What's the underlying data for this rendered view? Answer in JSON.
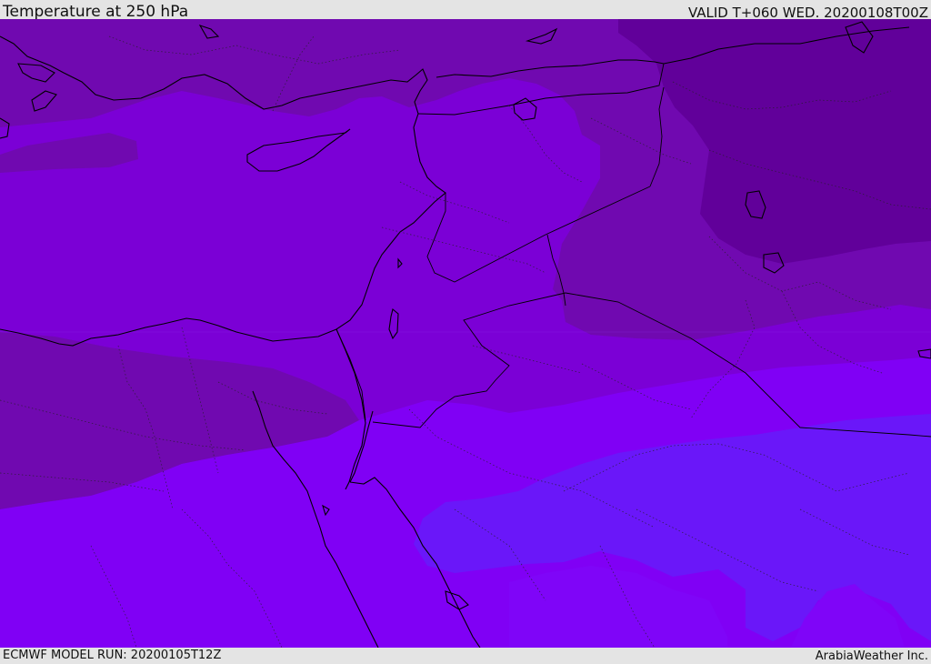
{
  "header": {
    "title": "Temperature at 250 hPa",
    "valid": "VALID T+060 WED. 20200108T00Z"
  },
  "footer": {
    "model_run": "ECMWF MODEL RUN: 20200105T12Z",
    "credit": "ArabiaWeather Inc."
  },
  "map": {
    "field": "temperature",
    "level": "250 hPa",
    "region": "Eastern Mediterranean, Levant, Egypt, Northern Arabia",
    "fill_colors": {
      "darkest_purple": "#61009a",
      "dark_purple": "#7009b0",
      "purple": "#7b00d6",
      "violet": "#8000f5",
      "blue_violet": "#6a17f9",
      "magenta_violet": "#7f05f8"
    }
  }
}
